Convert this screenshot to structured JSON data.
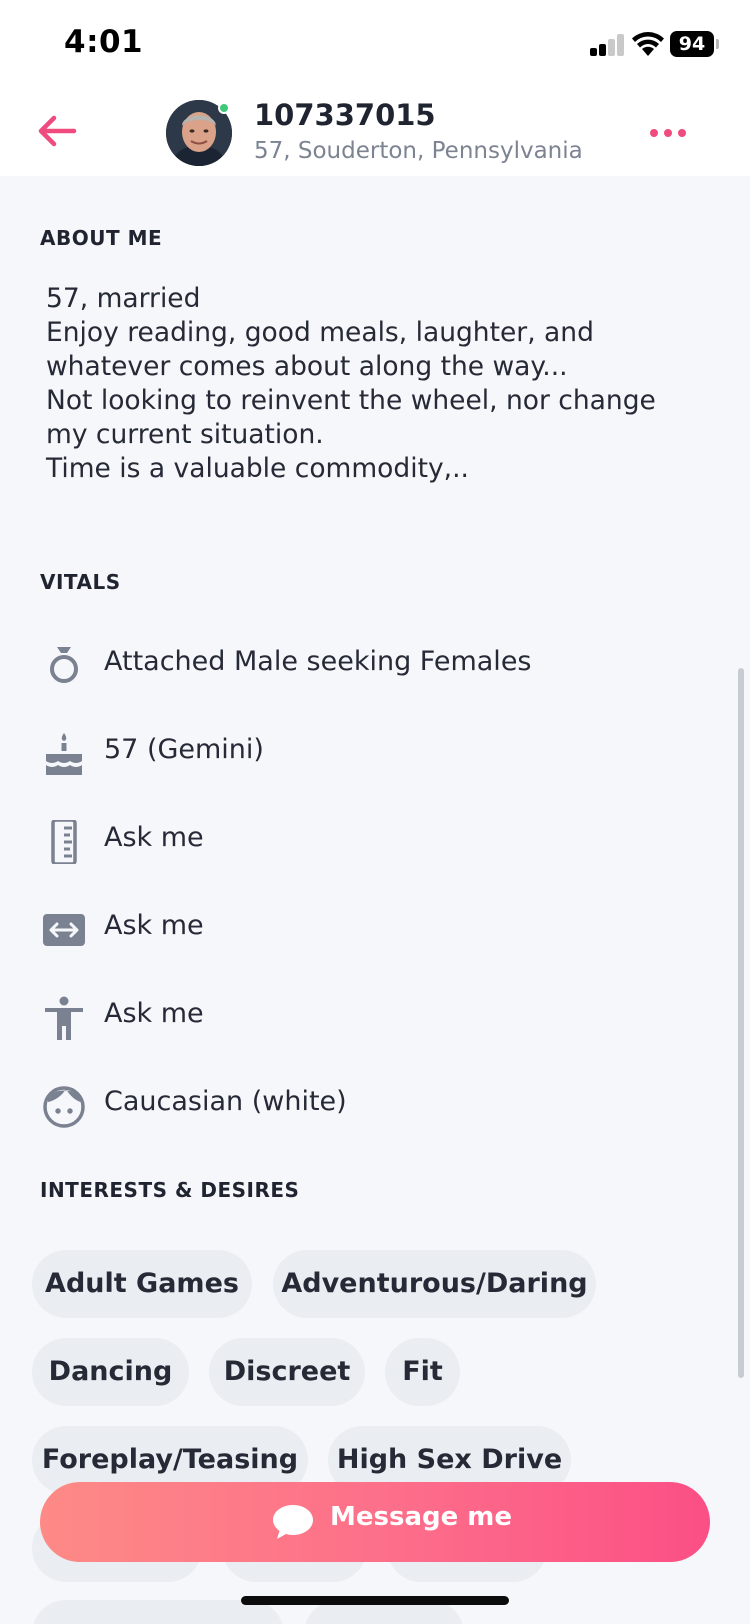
{
  "status_bar": {
    "time": "4:01",
    "battery": "94"
  },
  "header": {
    "username": "107337015",
    "location": "57, Souderton, Pennsylvania",
    "online": true
  },
  "about": {
    "title": "ABOUT ME",
    "lines": [
      "57, married",
      "Enjoy reading, good meals, laughter, and",
      "whatever comes about along the way...",
      "Not looking to reinvent the wheel, nor change",
      "my current situation.",
      "Time is a valuable commodity,.."
    ]
  },
  "vitals": {
    "title": "VITALS",
    "items": [
      {
        "icon": "ring-icon",
        "label": "Attached Male seeking Females"
      },
      {
        "icon": "cake-icon",
        "label": "57 (Gemini)"
      },
      {
        "icon": "ruler-icon",
        "label": "Ask me"
      },
      {
        "icon": "width-icon",
        "label": "Ask me"
      },
      {
        "icon": "body-icon",
        "label": "Ask me"
      },
      {
        "icon": "face-icon",
        "label": "Caucasian (white)"
      }
    ]
  },
  "interests": {
    "title": "INTERESTS & DESIRES",
    "chips": [
      "Adult Games",
      "Adventurous/Daring",
      "Dancing",
      "Discreet",
      "Fit",
      "Foreplay/Teasing",
      "High Sex Drive"
    ]
  },
  "message_button": {
    "label": "Message me"
  },
  "colors": {
    "accent": "#ef4b7e",
    "online": "#3ec97a",
    "background": "#f6f7fa",
    "chip": "#eaedf1"
  }
}
